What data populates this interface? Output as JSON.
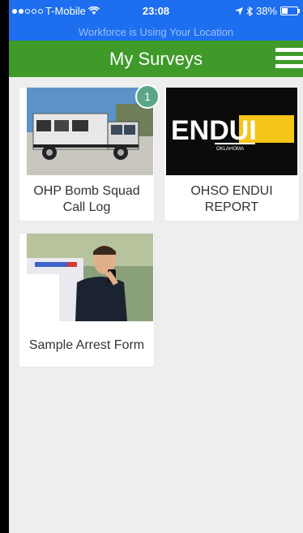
{
  "status_bar": {
    "carrier": "T-Mobile",
    "time": "23:08",
    "battery": "38%",
    "battery_level": 0.38,
    "location_banner": "Workforce is Using Your Location"
  },
  "appbar": {
    "title": "My Surveys"
  },
  "surveys": [
    {
      "label": "OHP Bomb Squad Call Log",
      "badge": "1",
      "image": "bomb-squad-truck"
    },
    {
      "label": "OHSO ENDUI REPORT",
      "badge": "",
      "image": "endui-logo",
      "logo_text": "ENDUI",
      "logo_subtext": "OKLAHOMA"
    },
    {
      "label": "Sample Arrest Form",
      "badge": "",
      "image": "police-officer"
    }
  ],
  "colors": {
    "status_bar": "#1e6ff0",
    "appbar": "#3f9a2a",
    "badge": "#5aa687",
    "endui_yellow": "#f5c518"
  }
}
